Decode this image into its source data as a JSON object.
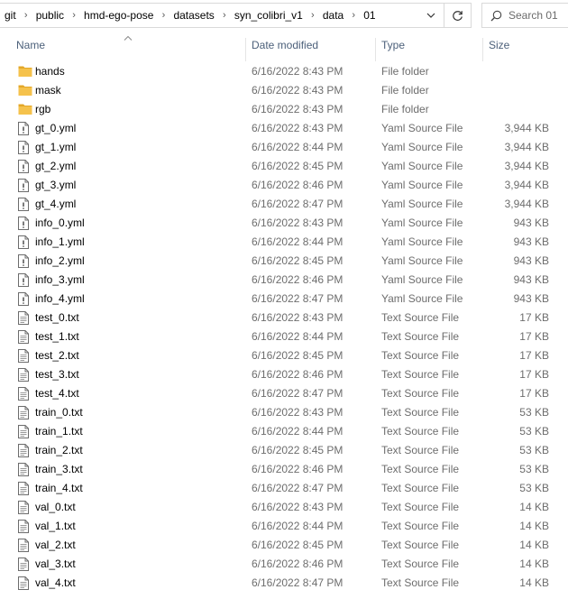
{
  "address_bar": {
    "crumbs": [
      "git",
      "public",
      "hmd-ego-pose",
      "datasets",
      "syn_colibri_v1",
      "data",
      "01"
    ]
  },
  "search": {
    "placeholder": "Search 01"
  },
  "columns": {
    "name": "Name",
    "date": "Date modified",
    "type": "Type",
    "size": "Size"
  },
  "files": [
    {
      "name": "hands",
      "date": "6/16/2022 8:43 PM",
      "type": "File folder",
      "size": "",
      "icon": "folder-icon"
    },
    {
      "name": "mask",
      "date": "6/16/2022 8:43 PM",
      "type": "File folder",
      "size": "",
      "icon": "folder-icon"
    },
    {
      "name": "rgb",
      "date": "6/16/2022 8:43 PM",
      "type": "File folder",
      "size": "",
      "icon": "folder-icon"
    },
    {
      "name": "gt_0.yml",
      "date": "6/16/2022 8:43 PM",
      "type": "Yaml Source File",
      "size": "3,944 KB",
      "icon": "yaml-file-icon"
    },
    {
      "name": "gt_1.yml",
      "date": "6/16/2022 8:44 PM",
      "type": "Yaml Source File",
      "size": "3,944 KB",
      "icon": "yaml-file-icon"
    },
    {
      "name": "gt_2.yml",
      "date": "6/16/2022 8:45 PM",
      "type": "Yaml Source File",
      "size": "3,944 KB",
      "icon": "yaml-file-icon"
    },
    {
      "name": "gt_3.yml",
      "date": "6/16/2022 8:46 PM",
      "type": "Yaml Source File",
      "size": "3,944 KB",
      "icon": "yaml-file-icon"
    },
    {
      "name": "gt_4.yml",
      "date": "6/16/2022 8:47 PM",
      "type": "Yaml Source File",
      "size": "3,944 KB",
      "icon": "yaml-file-icon"
    },
    {
      "name": "info_0.yml",
      "date": "6/16/2022 8:43 PM",
      "type": "Yaml Source File",
      "size": "943 KB",
      "icon": "yaml-file-icon"
    },
    {
      "name": "info_1.yml",
      "date": "6/16/2022 8:44 PM",
      "type": "Yaml Source File",
      "size": "943 KB",
      "icon": "yaml-file-icon"
    },
    {
      "name": "info_2.yml",
      "date": "6/16/2022 8:45 PM",
      "type": "Yaml Source File",
      "size": "943 KB",
      "icon": "yaml-file-icon"
    },
    {
      "name": "info_3.yml",
      "date": "6/16/2022 8:46 PM",
      "type": "Yaml Source File",
      "size": "943 KB",
      "icon": "yaml-file-icon"
    },
    {
      "name": "info_4.yml",
      "date": "6/16/2022 8:47 PM",
      "type": "Yaml Source File",
      "size": "943 KB",
      "icon": "yaml-file-icon"
    },
    {
      "name": "test_0.txt",
      "date": "6/16/2022 8:43 PM",
      "type": "Text Source File",
      "size": "17 KB",
      "icon": "text-file-icon"
    },
    {
      "name": "test_1.txt",
      "date": "6/16/2022 8:44 PM",
      "type": "Text Source File",
      "size": "17 KB",
      "icon": "text-file-icon"
    },
    {
      "name": "test_2.txt",
      "date": "6/16/2022 8:45 PM",
      "type": "Text Source File",
      "size": "17 KB",
      "icon": "text-file-icon"
    },
    {
      "name": "test_3.txt",
      "date": "6/16/2022 8:46 PM",
      "type": "Text Source File",
      "size": "17 KB",
      "icon": "text-file-icon"
    },
    {
      "name": "test_4.txt",
      "date": "6/16/2022 8:47 PM",
      "type": "Text Source File",
      "size": "17 KB",
      "icon": "text-file-icon"
    },
    {
      "name": "train_0.txt",
      "date": "6/16/2022 8:43 PM",
      "type": "Text Source File",
      "size": "53 KB",
      "icon": "text-file-icon"
    },
    {
      "name": "train_1.txt",
      "date": "6/16/2022 8:44 PM",
      "type": "Text Source File",
      "size": "53 KB",
      "icon": "text-file-icon"
    },
    {
      "name": "train_2.txt",
      "date": "6/16/2022 8:45 PM",
      "type": "Text Source File",
      "size": "53 KB",
      "icon": "text-file-icon"
    },
    {
      "name": "train_3.txt",
      "date": "6/16/2022 8:46 PM",
      "type": "Text Source File",
      "size": "53 KB",
      "icon": "text-file-icon"
    },
    {
      "name": "train_4.txt",
      "date": "6/16/2022 8:47 PM",
      "type": "Text Source File",
      "size": "53 KB",
      "icon": "text-file-icon"
    },
    {
      "name": "val_0.txt",
      "date": "6/16/2022 8:43 PM",
      "type": "Text Source File",
      "size": "14 KB",
      "icon": "text-file-icon"
    },
    {
      "name": "val_1.txt",
      "date": "6/16/2022 8:44 PM",
      "type": "Text Source File",
      "size": "14 KB",
      "icon": "text-file-icon"
    },
    {
      "name": "val_2.txt",
      "date": "6/16/2022 8:45 PM",
      "type": "Text Source File",
      "size": "14 KB",
      "icon": "text-file-icon"
    },
    {
      "name": "val_3.txt",
      "date": "6/16/2022 8:46 PM",
      "type": "Text Source File",
      "size": "14 KB",
      "icon": "text-file-icon"
    },
    {
      "name": "val_4.txt",
      "date": "6/16/2022 8:47 PM",
      "type": "Text Source File",
      "size": "14 KB",
      "icon": "text-file-icon"
    }
  ],
  "colors": {
    "folder": "#f5c24c",
    "folder_dark": "#e3a728",
    "header_text": "#4c607a",
    "secondary_text": "#6d6d6d",
    "border": "#d9d9d9"
  }
}
